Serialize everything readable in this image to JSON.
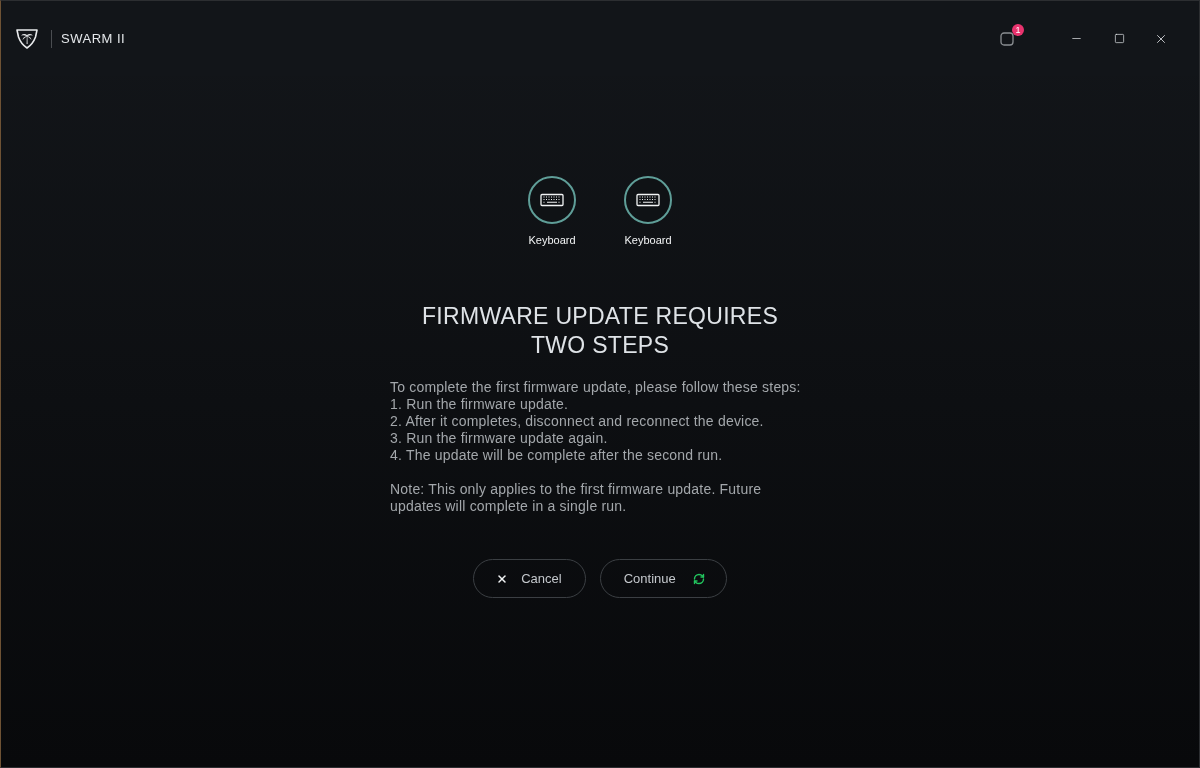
{
  "window": {
    "title": "SWARM II",
    "notifications": {
      "count": "1"
    }
  },
  "devices": [
    {
      "kind": "keyboard",
      "label": "Keyboard"
    },
    {
      "kind": "keyboard",
      "label": "Keyboard"
    }
  ],
  "dialog": {
    "title": "FIRMWARE UPDATE REQUIRES TWO STEPS",
    "intro": "To complete the first firmware update, please follow these steps:",
    "steps": [
      "1. Run the firmware update.",
      "2. After it completes, disconnect and reconnect the device.",
      "3. Run the firmware update again.",
      "4. The update will be complete after the second run."
    ],
    "note": "Note: This only applies to the first firmware update. Future updates will complete in a single run.",
    "buttons": [
      {
        "kind": "cancel",
        "label": "Cancel"
      },
      {
        "kind": "continue",
        "label": "Continue"
      }
    ]
  }
}
